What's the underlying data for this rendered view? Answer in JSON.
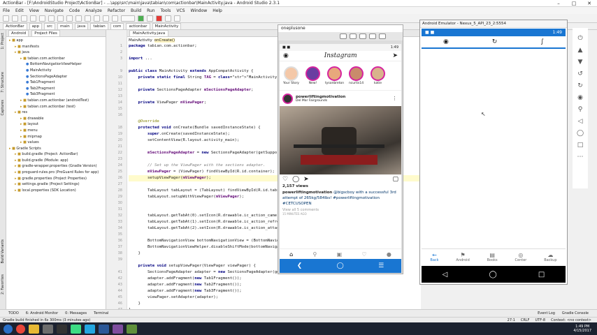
{
  "window": {
    "title": "ActionBar - [F:\\AndroidStudio Project\\ActionBar] - ...\\app\\src\\main\\java\\tabian\\com\\actionbar\\MainActivity.java - Android Studio 2.3.1"
  },
  "menu": [
    "File",
    "Edit",
    "View",
    "Navigate",
    "Code",
    "Analyze",
    "Refactor",
    "Build",
    "Run",
    "Tools",
    "VCS",
    "Window",
    "Help"
  ],
  "breadcrumbs": [
    "ActionBar",
    "app",
    "src",
    "main",
    "java",
    "tabian",
    "com",
    "actionbar",
    "MainActivity"
  ],
  "project": {
    "view": "Android",
    "files_label": "Project Files",
    "tree": [
      {
        "label": "app",
        "indent": 0
      },
      {
        "label": "manifests",
        "indent": 1
      },
      {
        "label": "java",
        "indent": 1
      },
      {
        "label": "tabian.com.actionbar",
        "indent": 2
      },
      {
        "label": "BottomNavigationViewHelper",
        "indent": 3
      },
      {
        "label": "MainActivity",
        "indent": 3
      },
      {
        "label": "SectionsPageAdapter",
        "indent": 3
      },
      {
        "label": "Tab1Fragment",
        "indent": 3
      },
      {
        "label": "Tab2Fragment",
        "indent": 3
      },
      {
        "label": "Tab3Fragment",
        "indent": 3
      },
      {
        "label": "tabian.com.actionbar (androidTest)",
        "indent": 2
      },
      {
        "label": "tabian.com.actionbar (test)",
        "indent": 2
      },
      {
        "label": "res",
        "indent": 1
      },
      {
        "label": "drawable",
        "indent": 2
      },
      {
        "label": "layout",
        "indent": 2
      },
      {
        "label": "menu",
        "indent": 2
      },
      {
        "label": "mipmap",
        "indent": 2
      },
      {
        "label": "values",
        "indent": 2
      },
      {
        "label": "Gradle Scripts",
        "indent": 0
      },
      {
        "label": "build.gradle (Project: ActionBar)",
        "indent": 1
      },
      {
        "label": "build.gradle (Module: app)",
        "indent": 1
      },
      {
        "label": "gradle-wrapper.properties (Gradle Version)",
        "indent": 1
      },
      {
        "label": "proguard-rules.pro (ProGuard Rules for app)",
        "indent": 1
      },
      {
        "label": "gradle.properties (Project Properties)",
        "indent": 1
      },
      {
        "label": "settings.gradle (Project Settings)",
        "indent": 1
      },
      {
        "label": "local.properties (SDK Location)",
        "indent": 1
      }
    ]
  },
  "side_tools": {
    "project": "1: Project",
    "structure": "7: Structure",
    "captures": "Captures",
    "variants": "Build Variants",
    "favorites": "2: Favorites"
  },
  "editor": {
    "file_tab": "MainActivity.java",
    "crumb_class": "MainActivity",
    "crumb_method": "onCreate()",
    "gutter": [
      "1",
      "2",
      "3",
      "",
      "9",
      "10",
      "11",
      "12",
      "13",
      "14",
      "15",
      "16",
      "",
      "18",
      "19",
      "20",
      "21",
      "22",
      "23",
      "24",
      "25",
      "26",
      "27",
      "28",
      "29",
      "30",
      "31",
      "32",
      "33",
      "34",
      "35",
      "36",
      "37",
      "38",
      "39",
      "",
      "41",
      "42",
      "43",
      "44",
      "45",
      "46",
      "47",
      "48",
      "49",
      "50"
    ]
  },
  "code_lines": [
    {
      "t": "package tabian.com.actionbar;",
      "c": ""
    },
    {
      "t": "",
      "c": ""
    },
    {
      "t": "import ...",
      "c": ""
    },
    {
      "t": "",
      "c": ""
    },
    {
      "t": "public class MainActivity extends AppCompatActivity {",
      "c": ""
    },
    {
      "t": "    private static final String TAG = \"MainActivity\";",
      "c": ""
    },
    {
      "t": "",
      "c": ""
    },
    {
      "t": "    private SectionsPageAdapter mSectionsPageAdapter;",
      "c": ""
    },
    {
      "t": "",
      "c": ""
    },
    {
      "t": "    private ViewPager mViewPager;",
      "c": ""
    },
    {
      "t": "",
      "c": ""
    },
    {
      "t": "",
      "c": ""
    },
    {
      "t": "    @Override",
      "c": "an"
    },
    {
      "t": "    protected void onCreate(Bundle savedInstanceState) {",
      "c": ""
    },
    {
      "t": "        super.onCreate(savedInstanceState);",
      "c": ""
    },
    {
      "t": "        setContentView(R.layout.activity_main);",
      "c": ""
    },
    {
      "t": "",
      "c": ""
    },
    {
      "t": "        mSectionsPageAdapter = new SectionsPageAdapter(getSupportFragmentManager());",
      "c": ""
    },
    {
      "t": "",
      "c": ""
    },
    {
      "t": "        // Set up the ViewPager with the sections adapter.",
      "c": "cm"
    },
    {
      "t": "        mViewPager = (ViewPager) findViewById(R.id.container);",
      "c": ""
    },
    {
      "t": "        setupViewPager(mViewPager);",
      "c": "hl"
    },
    {
      "t": "",
      "c": ""
    },
    {
      "t": "        TabLayout tabLayout = (TabLayout) findViewById(R.id.tabs);",
      "c": ""
    },
    {
      "t": "        tabLayout.setupWithViewPager(mViewPager);",
      "c": ""
    },
    {
      "t": "",
      "c": ""
    },
    {
      "t": "",
      "c": ""
    },
    {
      "t": "        tabLayout.getTabAt(0).setIcon(R.drawable.ic_action_camera);",
      "c": ""
    },
    {
      "t": "        tabLayout.getTabAt(1).setIcon(R.drawable.ic_action_refresh);",
      "c": ""
    },
    {
      "t": "        tabLayout.getTabAt(2).setIcon(R.drawable.ic_action_attach);",
      "c": ""
    },
    {
      "t": "",
      "c": ""
    },
    {
      "t": "        BottomNavigationView bottomNavigationView = (BottomNavigationView) findViewById(R.id.bottomNavView_Bar);",
      "c": ""
    },
    {
      "t": "        BottomNavigationViewHelper.disableShiftMode(bottomNavigationView);",
      "c": ""
    },
    {
      "t": "    }",
      "c": ""
    },
    {
      "t": "",
      "c": ""
    },
    {
      "t": "    private void setupViewPager(ViewPager viewPager) {",
      "c": ""
    },
    {
      "t": "        SectionsPageAdapter adapter = new SectionsPageAdapter(getSupportFragmentManager());",
      "c": ""
    },
    {
      "t": "        adapter.addFragment(new Tab1Fragment());",
      "c": ""
    },
    {
      "t": "        adapter.addFragment(new Tab2Fragment());",
      "c": ""
    },
    {
      "t": "        adapter.addFragment(new Tab3Fragment());",
      "c": ""
    },
    {
      "t": "        viewPager.setAdapter(adapter);",
      "c": ""
    },
    {
      "t": "    }",
      "c": ""
    },
    {
      "t": "}",
      "c": ""
    }
  ],
  "bottom_tools": {
    "todo": "TODO",
    "monitor": "6: Android Monitor",
    "messages": "0: Messages",
    "terminal": "Terminal",
    "event_log": "Event Log",
    "gradle_console": "Gradle Console"
  },
  "status": {
    "message": "Gradle build finished in 6s 300ms (3 minutes ago)",
    "position": "27:1",
    "line_sep": "CRLF",
    "encoding": "UTF-8",
    "context": "Context: <no context>"
  },
  "taskbar": {
    "time": "1:49 PM",
    "date": "4/15/2017"
  },
  "phone1": {
    "device": "oneplusone",
    "time": "1:49",
    "app": "Instagram",
    "stories": [
      "Your Story",
      "New!",
      "tysonbreton",
      "ncurtis14",
      "katie"
    ],
    "post_user": "powerliftingmotivation",
    "post_location": "Del Mar Fairgrounds",
    "views": "2,157 views",
    "caption_user": "powerliftingmotivation",
    "caption": "@bigscboy with a successful 3rd attempt of 265kg/584lbs! #powerliftingmotivation #CETCUSOPEN",
    "comments": "View all 5 comments",
    "ago": "15 MINUTES AGO"
  },
  "phone2": {
    "title": "Android Emulator - Nexus_5_API_23_2:5554",
    "time": "1:49",
    "bottom_nav": [
      "Back",
      "Android",
      "Books",
      "Center",
      "Backup"
    ]
  },
  "colors": {
    "primary": "#1976d2",
    "instagram_ring": "#d6249f",
    "keyword": "#000080",
    "string": "#008000"
  }
}
